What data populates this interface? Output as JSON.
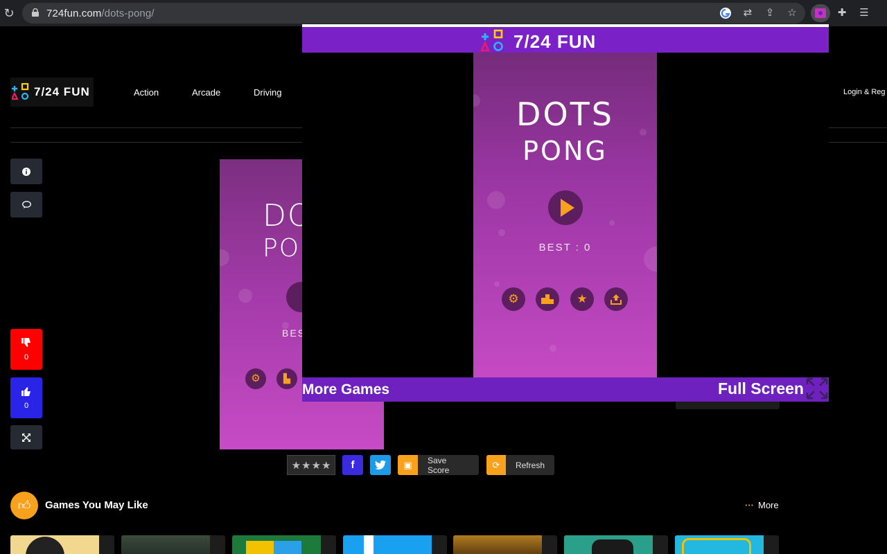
{
  "browser": {
    "url_host": "724fun.com",
    "url_path": "/dots-pong/"
  },
  "site": {
    "brand": "7/24 FUN",
    "nav": [
      "Action",
      "Arcade",
      "Driving"
    ],
    "login": "Login & Reg"
  },
  "sidebar": {
    "dislike_count": "0",
    "like_count": "0"
  },
  "popup": {
    "brand": "7/24 FUN",
    "more_games": "More Games",
    "full_screen": "Full Screen"
  },
  "game": {
    "title_line1": "DOTS",
    "title_line2": "PONG",
    "best": "BEST : 0",
    "bg_title_line1": "DO",
    "bg_title_line2": "PO",
    "bg_best": "BES"
  },
  "actions": {
    "save_score": "Save Score",
    "refresh": "Refresh"
  },
  "related": {
    "title": "Games You May Like",
    "more": "More"
  },
  "colors": {
    "accent_orange": "#f8a11c",
    "popup_purple": "#7a22c8",
    "dislike_red": "#ff0000",
    "like_blue": "#2a24e8",
    "facebook": "#3b2be0",
    "twitter": "#1e9be8"
  }
}
